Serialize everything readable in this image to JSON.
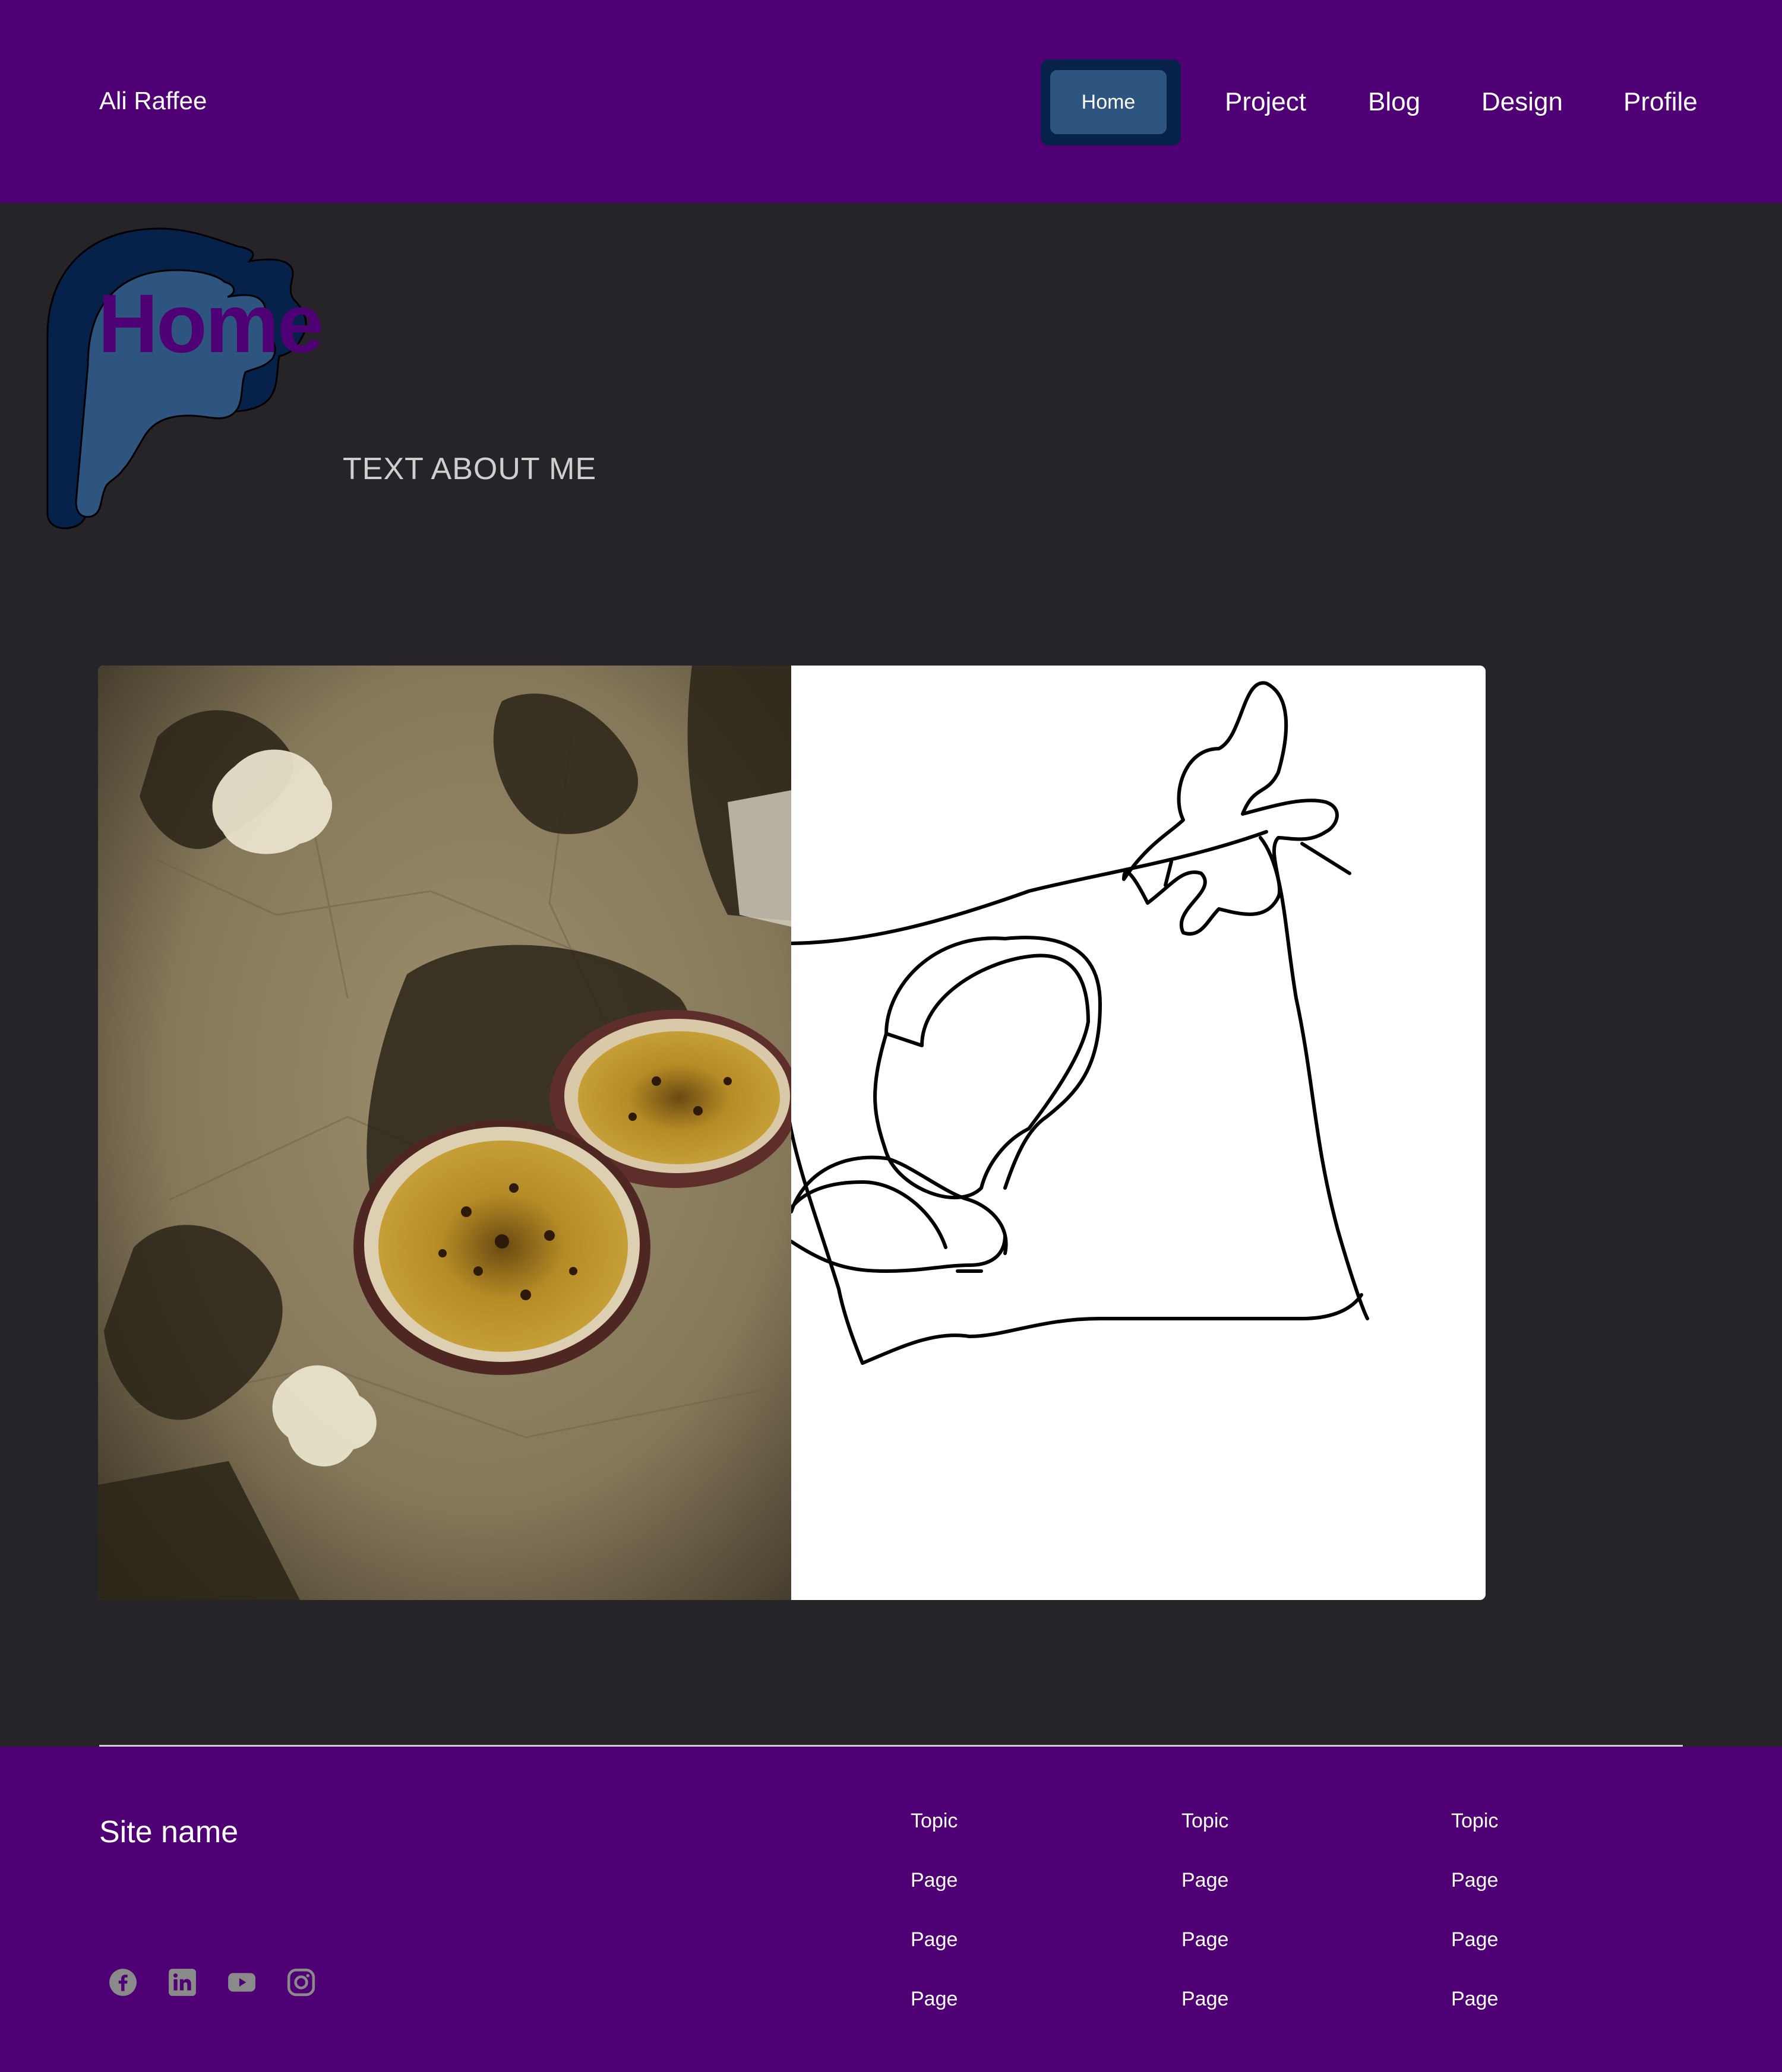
{
  "header": {
    "brand": "Ali Raffee",
    "nav": [
      {
        "label": "Home",
        "active": true
      },
      {
        "label": "Project"
      },
      {
        "label": "Blog"
      },
      {
        "label": "Design"
      },
      {
        "label": "Profile"
      }
    ]
  },
  "hero": {
    "title": "Home",
    "subtitle": "TEXT ABOUT ME"
  },
  "media": {
    "photo_description_icon": "photo-icon",
    "sketch_icon": "sketch-icon"
  },
  "footer": {
    "site_name": "Site name",
    "socials": [
      {
        "icon": "facebook-icon"
      },
      {
        "icon": "linkedin-icon"
      },
      {
        "icon": "youtube-icon"
      },
      {
        "icon": "instagram-icon"
      }
    ],
    "columns": [
      {
        "topic": "Topic",
        "pages": [
          "Page",
          "Page",
          "Page"
        ]
      },
      {
        "topic": "Topic",
        "pages": [
          "Page",
          "Page",
          "Page"
        ]
      },
      {
        "topic": "Topic",
        "pages": [
          "Page",
          "Page",
          "Page"
        ]
      }
    ]
  },
  "colors": {
    "header_bg": "#4f0074",
    "page_bg": "#262428",
    "accent_navy": "#06224a",
    "accent_blue": "#2e5580",
    "title_purple": "#4f0074",
    "social_icon": "#8a8a8a"
  }
}
